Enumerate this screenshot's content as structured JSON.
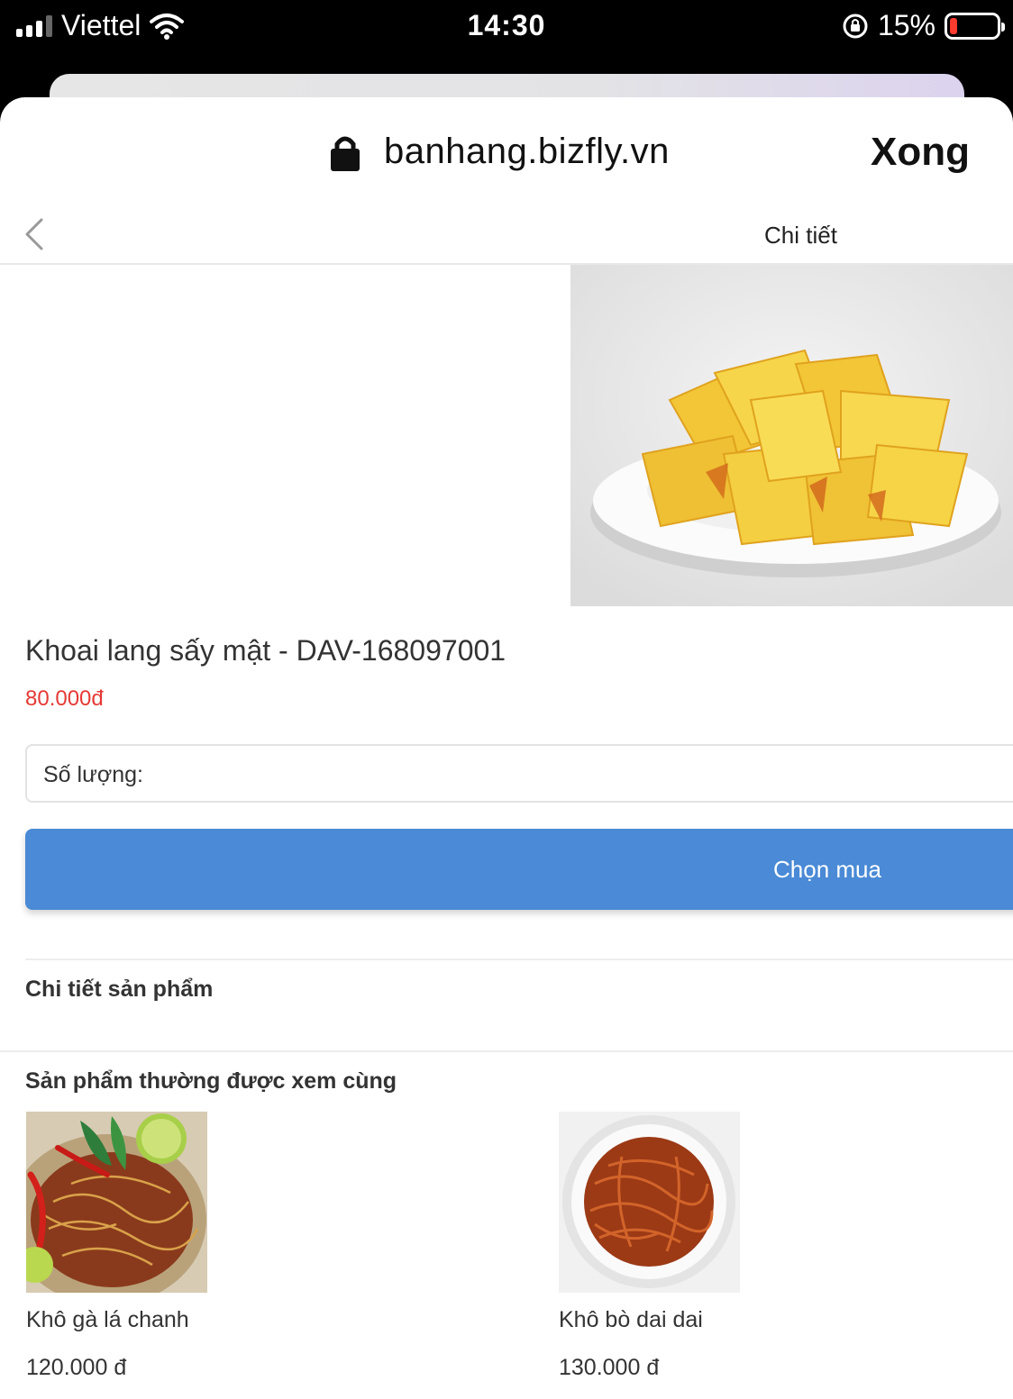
{
  "status_bar": {
    "carrier": "Viettel",
    "time": "14:30",
    "battery_percent": "15%",
    "battery_level": 0.15,
    "icons": [
      "signal-icon",
      "wifi-icon",
      "rotation-lock-icon",
      "battery-icon"
    ]
  },
  "browser": {
    "url": "banhang.bizfly.vn",
    "done_label": "Xong",
    "icons": [
      "padlock-icon"
    ]
  },
  "page": {
    "title": "Chi tiết",
    "icons": [
      "back-chevron-icon"
    ]
  },
  "product": {
    "name": "Khoai lang sấy mật - DAV-168097001",
    "price": "80.000đ",
    "quantity_label": "Số lượng:",
    "buy_label": "Chọn mua"
  },
  "sections": {
    "details_heading": "Chi tiết sản phẩm",
    "related_heading": "Sản phẩm thường được xem cùng"
  },
  "related": [
    {
      "name": "Khô gà lá chanh",
      "price": "120.000 đ"
    },
    {
      "name": "Khô bò dai dai",
      "price": "130.000 đ"
    }
  ],
  "colors": {
    "price_red": "#e53935",
    "button_blue": "#4a8ad6",
    "battery_red": "#ff3b30"
  }
}
